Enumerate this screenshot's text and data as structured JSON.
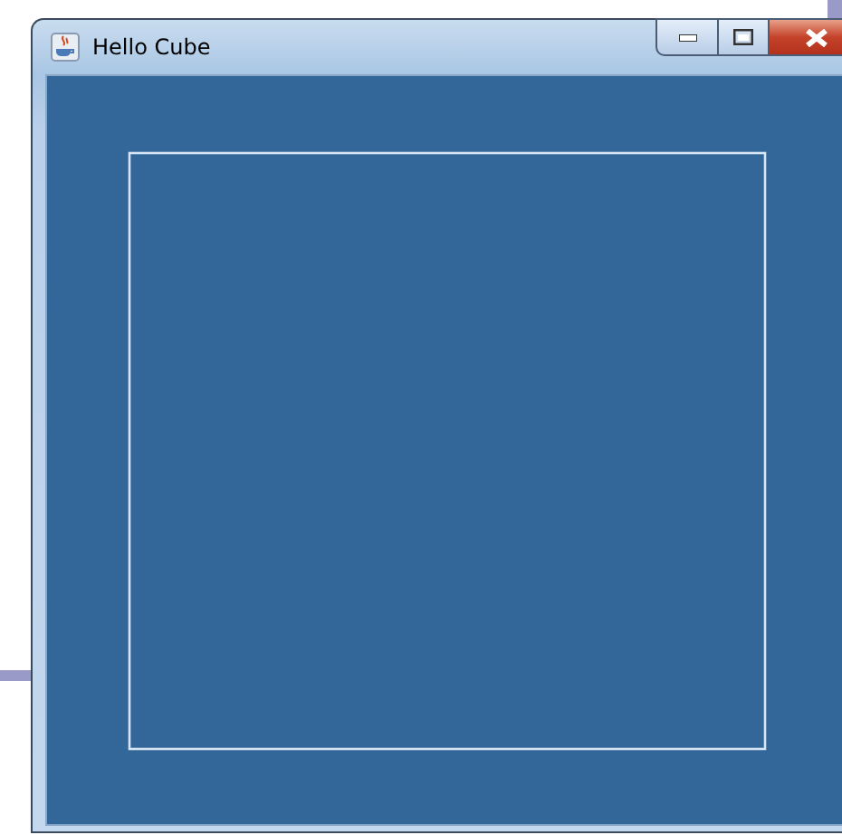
{
  "window": {
    "title": "Hello Cube"
  }
}
